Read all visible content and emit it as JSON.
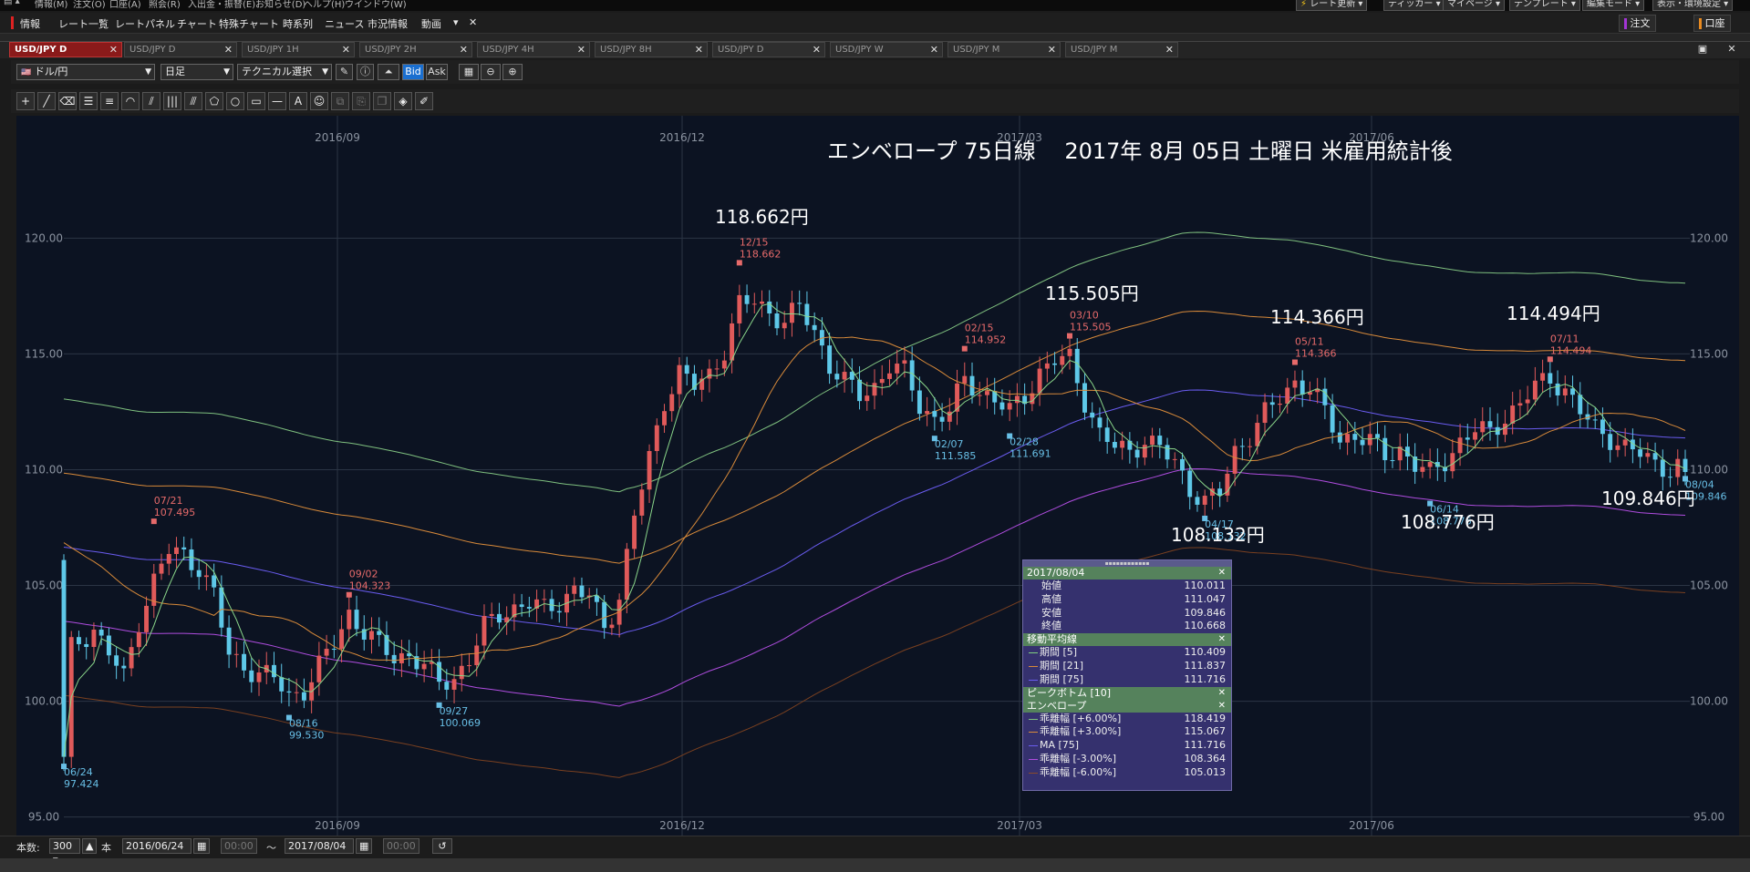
{
  "menu": {
    "items": [
      "情報(M)",
      "注文(O)",
      "口座(A)",
      "照会(R)",
      "入出金・振替(E)",
      "お知らせ(D)",
      "ヘルプ(H)",
      "ウインドウ(W)"
    ],
    "right": [
      "レート更新",
      "ティッカー",
      "マイページ",
      "テンプレート",
      "編集モード",
      "表示・環境設定"
    ]
  },
  "nav": {
    "items": [
      "情報",
      "レート一覧",
      "レートパネル",
      "チャート",
      "特殊チャート",
      "時系列",
      "ニュース",
      "市況情報",
      "動画"
    ],
    "order": "注文",
    "account": "口座"
  },
  "tabs": [
    "USD/JPY D",
    "USD/JPY D",
    "USD/JPY 1H",
    "USD/JPY 2H",
    "USD/JPY 4H",
    "USD/JPY 8H",
    "USD/JPY D",
    "USD/JPY W",
    "USD/JPY M",
    "USD/JPY M"
  ],
  "toolbar": {
    "pair": "ドル/円",
    "period": "日足",
    "technical": "テクニカル選択",
    "bid": "Bid",
    "ask": "Ask"
  },
  "status": {
    "count_label": "本数:",
    "count": "300",
    "unit": "本",
    "from_date": "2016/06/24",
    "from_time": "00:00",
    "tilde": "〜",
    "to_date": "2017/08/04",
    "to_time": "00:00"
  },
  "annotation": {
    "title": "エンベロープ 75日線　 2017年 8月 05日 土曜日 米雇用統計後"
  },
  "info_panel": {
    "date": "2017/08/04",
    "ohlc": [
      {
        "label": "始値",
        "value": "110.011"
      },
      {
        "label": "高値",
        "value": "111.047"
      },
      {
        "label": "安値",
        "value": "109.846"
      },
      {
        "label": "終値",
        "value": "110.668"
      }
    ],
    "ma_title": "移動平均線",
    "ma": [
      {
        "label": "期間 [5]",
        "value": "110.409",
        "color": "#7fd07f"
      },
      {
        "label": "期間 [21]",
        "value": "111.837",
        "color": "#d88a3a"
      },
      {
        "label": "期間 [75]",
        "value": "111.716",
        "color": "#6a5cf0"
      }
    ],
    "peak_title": "ピークボトム [10]",
    "env_title": "エンベロープ",
    "env": [
      {
        "label": "乖離幅 [+6.00%]",
        "value": "118.419",
        "color": "#7fc07f"
      },
      {
        "label": "乖離幅 [+3.00%]",
        "value": "115.067",
        "color": "#d88a3a"
      },
      {
        "label": "MA [75]",
        "value": "111.716",
        "color": "#6a5cf0"
      },
      {
        "label": "乖離幅 [-3.00%]",
        "value": "108.364",
        "color": "#b04de0"
      },
      {
        "label": "乖離幅 [-6.00%]",
        "value": "105.013",
        "color": "#8a4a2a"
      }
    ]
  },
  "chart_data": {
    "type": "candlestick",
    "x_date_labels": [
      "2016/09",
      "2016/12",
      "2017/03",
      "2017/06"
    ],
    "y_ticks": [
      "95.00",
      "100.00",
      "105.00",
      "110.00",
      "115.00",
      "120.00"
    ],
    "ylim": [
      94.2,
      124.5
    ],
    "date_range": [
      "2016/06/24",
      "2017/08/04"
    ],
    "grid": true,
    "colors": {
      "up": "#e05a5a",
      "down": "#5ec8e8",
      "ma5": "#8ad68a",
      "ma21": "#d88a3a",
      "ma75": "#6a5cf0",
      "env_p6": "#7fc07f",
      "env_p3": "#d88a3a",
      "env_m3": "#b04de0",
      "env_m6": "#7a4020"
    },
    "peaks": [
      {
        "date": "06/24",
        "value": "97.424",
        "kind": "bottom"
      },
      {
        "date": "07/21",
        "value": "107.495",
        "kind": "peak"
      },
      {
        "date": "08/16",
        "value": "99.530",
        "kind": "bottom"
      },
      {
        "date": "09/02",
        "value": "104.323",
        "kind": "peak"
      },
      {
        "date": "09/27",
        "value": "100.069",
        "kind": "bottom"
      },
      {
        "date": "12/15",
        "value": "118.662",
        "kind": "peak"
      },
      {
        "date": "02/07",
        "value": "111.585",
        "kind": "bottom"
      },
      {
        "date": "02/15",
        "value": "114.952",
        "kind": "peak"
      },
      {
        "date": "02/28",
        "value": "111.691",
        "kind": "bottom"
      },
      {
        "date": "03/10",
        "value": "115.505",
        "kind": "peak"
      },
      {
        "date": "04/17",
        "value": "108.132",
        "kind": "bottom"
      },
      {
        "date": "05/11",
        "value": "114.366",
        "kind": "peak"
      },
      {
        "date": "06/14",
        "value": "108.776",
        "kind": "bottom"
      },
      {
        "date": "07/11",
        "value": "114.494",
        "kind": "peak"
      },
      {
        "date": "08/04",
        "value": "109.846",
        "kind": "bottom"
      }
    ],
    "big_labels": [
      {
        "text": "118.662円",
        "value": 118.662
      },
      {
        "text": "115.505円",
        "value": 115.505
      },
      {
        "text": "114.366円",
        "value": 114.366
      },
      {
        "text": "114.494円",
        "value": 114.494
      },
      {
        "text": "108.132円",
        "value": 108.132
      },
      {
        "text": "108.776円",
        "value": 108.776
      },
      {
        "text": "109.846円",
        "value": 109.846
      }
    ],
    "closes": [
      [
        0,
        102.0
      ],
      [
        2,
        102.6
      ],
      [
        4,
        103.1
      ],
      [
        6,
        102.1
      ],
      [
        8,
        101.0
      ],
      [
        10,
        103.5
      ],
      [
        12,
        105.2
      ],
      [
        14,
        106.5
      ],
      [
        16,
        106.3
      ],
      [
        18,
        105.8
      ],
      [
        20,
        104.6
      ],
      [
        22,
        102.0
      ],
      [
        24,
        101.5
      ],
      [
        26,
        101.2
      ],
      [
        28,
        101.0
      ],
      [
        30,
        100.2
      ],
      [
        32,
        100.5
      ],
      [
        34,
        101.5
      ],
      [
        36,
        102.5
      ],
      [
        38,
        103.8
      ],
      [
        40,
        103.0
      ],
      [
        42,
        102.4
      ],
      [
        44,
        101.9
      ],
      [
        46,
        102.0
      ],
      [
        48,
        101.5
      ],
      [
        50,
        100.8
      ],
      [
        52,
        101.0
      ],
      [
        54,
        101.8
      ],
      [
        56,
        103.2
      ],
      [
        58,
        103.8
      ],
      [
        60,
        104.0
      ],
      [
        62,
        104.2
      ],
      [
        64,
        104.0
      ],
      [
        66,
        104.3
      ],
      [
        68,
        104.8
      ],
      [
        70,
        104.5
      ],
      [
        72,
        103.2
      ],
      [
        74,
        104.5
      ],
      [
        76,
        108.0
      ],
      [
        78,
        110.5
      ],
      [
        80,
        113.0
      ],
      [
        82,
        114.2
      ],
      [
        84,
        113.6
      ],
      [
        86,
        114.1
      ],
      [
        88,
        115.2
      ],
      [
        90,
        117.1
      ],
      [
        92,
        117.3
      ],
      [
        94,
        116.8
      ],
      [
        96,
        116.4
      ],
      [
        98,
        117.0
      ],
      [
        100,
        116.0
      ],
      [
        102,
        114.5
      ],
      [
        104,
        113.8
      ],
      [
        106,
        113.2
      ],
      [
        108,
        113.6
      ],
      [
        110,
        114.5
      ],
      [
        112,
        114.2
      ],
      [
        114,
        112.8
      ],
      [
        116,
        112.2
      ],
      [
        118,
        112.5
      ],
      [
        120,
        113.9
      ],
      [
        122,
        113.4
      ],
      [
        124,
        113.0
      ],
      [
        126,
        112.5
      ],
      [
        128,
        113.2
      ],
      [
        130,
        114.2
      ],
      [
        132,
        114.7
      ],
      [
        134,
        114.8
      ],
      [
        136,
        113.0
      ],
      [
        138,
        111.5
      ],
      [
        140,
        111.0
      ],
      [
        142,
        110.8
      ],
      [
        144,
        111.3
      ],
      [
        146,
        110.9
      ],
      [
        148,
        110.3
      ],
      [
        150,
        109.2
      ],
      [
        152,
        108.6
      ],
      [
        154,
        109.0
      ],
      [
        156,
        110.8
      ],
      [
        158,
        111.5
      ],
      [
        160,
        112.4
      ],
      [
        162,
        113.1
      ],
      [
        164,
        113.8
      ],
      [
        166,
        113.5
      ],
      [
        168,
        112.5
      ],
      [
        170,
        111.3
      ],
      [
        172,
        111.5
      ],
      [
        174,
        111.2
      ],
      [
        176,
        110.6
      ],
      [
        178,
        110.9
      ],
      [
        180,
        110.2
      ],
      [
        182,
        109.8
      ],
      [
        184,
        110.4
      ],
      [
        186,
        111.2
      ],
      [
        188,
        111.7
      ],
      [
        190,
        111.6
      ],
      [
        192,
        112.3
      ],
      [
        194,
        112.8
      ],
      [
        196,
        113.6
      ],
      [
        198,
        114.0
      ],
      [
        200,
        113.4
      ],
      [
        202,
        112.5
      ],
      [
        204,
        111.8
      ],
      [
        206,
        111.4
      ],
      [
        208,
        110.9
      ],
      [
        210,
        110.7
      ],
      [
        212,
        110.3
      ],
      [
        214,
        110.0
      ],
      [
        216,
        110.2
      ]
    ]
  }
}
